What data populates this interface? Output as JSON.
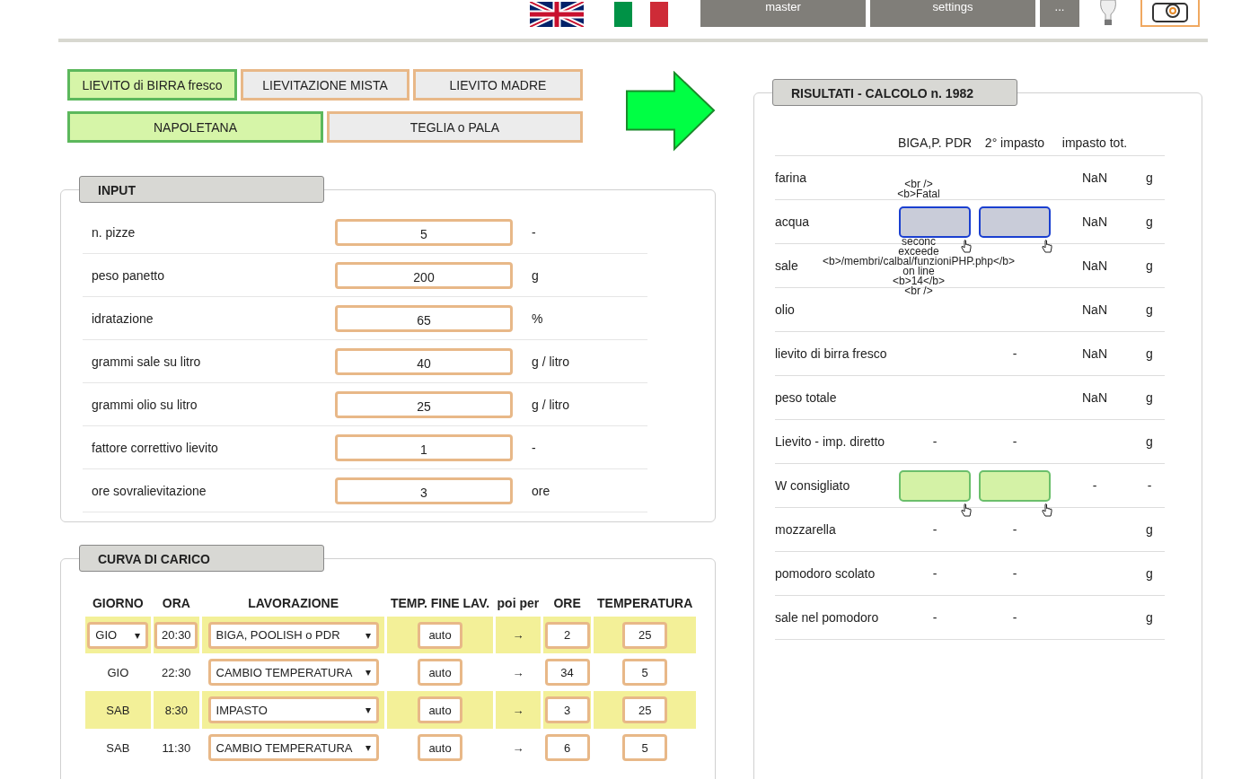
{
  "header": {
    "languages": [
      {
        "kind": "uk"
      },
      {
        "kind": "it"
      }
    ],
    "buttons": [
      "master",
      "settings",
      "..."
    ]
  },
  "mode_tabs": [
    [
      {
        "label": "LIEVITO di BIRRA fresco",
        "selected": true
      },
      {
        "label": "LIEVITAZIONE MISTA",
        "selected": false
      },
      {
        "label": "LIEVITO MADRE",
        "selected": false
      }
    ],
    [
      {
        "label": "NAPOLETANA",
        "selected": true
      },
      {
        "label": "TEGLIA o PALA",
        "selected": false
      }
    ]
  ],
  "input": {
    "title": "INPUT",
    "rows": [
      {
        "label": "n. pizze",
        "value": "5",
        "unit": "-"
      },
      {
        "label": "peso panetto",
        "value": "200",
        "unit": "g"
      },
      {
        "label": "idratazione",
        "value": "65",
        "unit": "%"
      },
      {
        "label": "grammi sale su litro",
        "value": "40",
        "unit": "g / litro"
      },
      {
        "label": "grammi olio su litro",
        "value": "25",
        "unit": "g / litro"
      },
      {
        "label": "fattore correttivo lievito",
        "value": "1",
        "unit": "-"
      },
      {
        "label": "ore sovralievitazione",
        "value": "3",
        "unit": "ore"
      }
    ]
  },
  "curve": {
    "title": "CURVA DI CARICO",
    "dropdown_caret": "▾",
    "columns": [
      "GIORNO",
      "ORA",
      "LAVORAZIONE",
      "TEMP. FINE LAV.",
      "poi per",
      "ORE",
      "TEMPERATURA"
    ],
    "rows": [
      {
        "kind": "editable",
        "day": "GIO",
        "time": "20:30",
        "step": "BIGA, POOLISH o PDR",
        "end_temp": "auto",
        "arrow": "→",
        "hours": "2",
        "temperature": "25"
      },
      {
        "kind": "fixed",
        "day": "GIO",
        "time": "22:30",
        "step": "CAMBIO TEMPERATURA",
        "end_temp": "auto",
        "arrow": "→",
        "hours": "34",
        "temperature": "5"
      },
      {
        "kind": "fixed",
        "day": "SAB",
        "time": "8:30",
        "step": "IMPASTO",
        "end_temp": "auto",
        "arrow": "→",
        "hours": "3",
        "temperature": "25"
      },
      {
        "kind": "fixed",
        "day": "SAB",
        "time": "11:30",
        "step": "CAMBIO TEMPERATURA",
        "end_temp": "auto",
        "arrow": "→",
        "hours": "6",
        "temperature": "5"
      }
    ]
  },
  "results": {
    "title": "RISULTATI - CALCOLO n. 1982",
    "columns": [
      "BIGA,P. PDR",
      "2° impasto",
      "impasto tot."
    ],
    "error_lines": [
      "<br />",
      "<b>Fatal",
      "seconc",
      "exceede",
      "<b>/membri/calbal/funzioniPHP.php</b>",
      "on line",
      "<b>14</b>",
      "<br />"
    ],
    "rows": [
      {
        "kind": "text",
        "label": "farina",
        "col_1": "",
        "col_2": "",
        "total": "NaN",
        "unit": "g"
      },
      {
        "kind": "boxes",
        "label": "acqua",
        "color": "#c9ccd9",
        "total": "NaN",
        "unit": "g"
      },
      {
        "kind": "text",
        "label": "sale",
        "col_1": "",
        "col_2": "",
        "total": "NaN",
        "unit": "g"
      },
      {
        "kind": "text",
        "label": "olio",
        "col_1": "",
        "col_2": "",
        "total": "NaN",
        "unit": "g"
      },
      {
        "kind": "text",
        "label": "lievito di birra fresco",
        "col_1": "",
        "col_2": "-",
        "total": "NaN",
        "unit": "g"
      },
      {
        "kind": "text",
        "label": "peso totale",
        "col_1": "",
        "col_2": "",
        "total": "NaN",
        "unit": "g"
      },
      {
        "kind": "text",
        "label": "Lievito - imp. diretto",
        "col_1": "-",
        "col_2": "-",
        "total": "",
        "unit": "g"
      },
      {
        "kind": "boxes",
        "label": "W consigliato",
        "color": "#d4f2a6",
        "total": "-",
        "unit": "-"
      },
      {
        "kind": "text",
        "label": "mozzarella",
        "col_1": "-",
        "col_2": "-",
        "total": "",
        "unit": "g"
      },
      {
        "kind": "text",
        "label": "pomodoro scolato",
        "col_1": "-",
        "col_2": "-",
        "total": "",
        "unit": "g"
      },
      {
        "kind": "text",
        "label": "sale nel pomodoro",
        "col_1": "-",
        "col_2": "-",
        "total": "",
        "unit": "g"
      }
    ]
  }
}
